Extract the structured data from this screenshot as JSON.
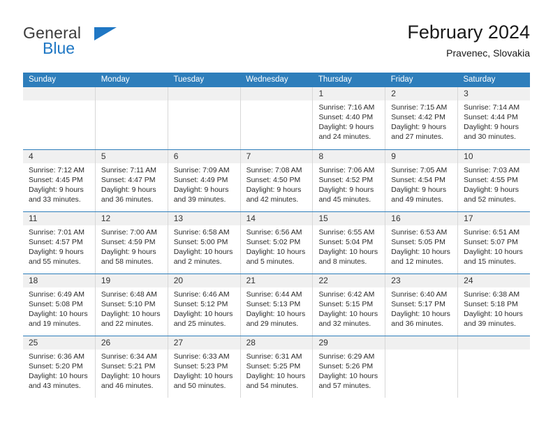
{
  "brand": {
    "name_part1": "General",
    "name_part2": "Blue",
    "accent_color": "#1f77c4"
  },
  "header": {
    "title": "February 2024",
    "location": "Pravenec, Slovakia"
  },
  "calendar": {
    "header_color": "#2e7ebb",
    "weekdays": [
      "Sunday",
      "Monday",
      "Tuesday",
      "Wednesday",
      "Thursday",
      "Friday",
      "Saturday"
    ],
    "weeks": [
      [
        {
          "day": "",
          "sunrise": "",
          "sunset": "",
          "daylight1": "",
          "daylight2": ""
        },
        {
          "day": "",
          "sunrise": "",
          "sunset": "",
          "daylight1": "",
          "daylight2": ""
        },
        {
          "day": "",
          "sunrise": "",
          "sunset": "",
          "daylight1": "",
          "daylight2": ""
        },
        {
          "day": "",
          "sunrise": "",
          "sunset": "",
          "daylight1": "",
          "daylight2": ""
        },
        {
          "day": "1",
          "sunrise": "Sunrise: 7:16 AM",
          "sunset": "Sunset: 4:40 PM",
          "daylight1": "Daylight: 9 hours",
          "daylight2": "and 24 minutes."
        },
        {
          "day": "2",
          "sunrise": "Sunrise: 7:15 AM",
          "sunset": "Sunset: 4:42 PM",
          "daylight1": "Daylight: 9 hours",
          "daylight2": "and 27 minutes."
        },
        {
          "day": "3",
          "sunrise": "Sunrise: 7:14 AM",
          "sunset": "Sunset: 4:44 PM",
          "daylight1": "Daylight: 9 hours",
          "daylight2": "and 30 minutes."
        }
      ],
      [
        {
          "day": "4",
          "sunrise": "Sunrise: 7:12 AM",
          "sunset": "Sunset: 4:45 PM",
          "daylight1": "Daylight: 9 hours",
          "daylight2": "and 33 minutes."
        },
        {
          "day": "5",
          "sunrise": "Sunrise: 7:11 AM",
          "sunset": "Sunset: 4:47 PM",
          "daylight1": "Daylight: 9 hours",
          "daylight2": "and 36 minutes."
        },
        {
          "day": "6",
          "sunrise": "Sunrise: 7:09 AM",
          "sunset": "Sunset: 4:49 PM",
          "daylight1": "Daylight: 9 hours",
          "daylight2": "and 39 minutes."
        },
        {
          "day": "7",
          "sunrise": "Sunrise: 7:08 AM",
          "sunset": "Sunset: 4:50 PM",
          "daylight1": "Daylight: 9 hours",
          "daylight2": "and 42 minutes."
        },
        {
          "day": "8",
          "sunrise": "Sunrise: 7:06 AM",
          "sunset": "Sunset: 4:52 PM",
          "daylight1": "Daylight: 9 hours",
          "daylight2": "and 45 minutes."
        },
        {
          "day": "9",
          "sunrise": "Sunrise: 7:05 AM",
          "sunset": "Sunset: 4:54 PM",
          "daylight1": "Daylight: 9 hours",
          "daylight2": "and 49 minutes."
        },
        {
          "day": "10",
          "sunrise": "Sunrise: 7:03 AM",
          "sunset": "Sunset: 4:55 PM",
          "daylight1": "Daylight: 9 hours",
          "daylight2": "and 52 minutes."
        }
      ],
      [
        {
          "day": "11",
          "sunrise": "Sunrise: 7:01 AM",
          "sunset": "Sunset: 4:57 PM",
          "daylight1": "Daylight: 9 hours",
          "daylight2": "and 55 minutes."
        },
        {
          "day": "12",
          "sunrise": "Sunrise: 7:00 AM",
          "sunset": "Sunset: 4:59 PM",
          "daylight1": "Daylight: 9 hours",
          "daylight2": "and 58 minutes."
        },
        {
          "day": "13",
          "sunrise": "Sunrise: 6:58 AM",
          "sunset": "Sunset: 5:00 PM",
          "daylight1": "Daylight: 10 hours",
          "daylight2": "and 2 minutes."
        },
        {
          "day": "14",
          "sunrise": "Sunrise: 6:56 AM",
          "sunset": "Sunset: 5:02 PM",
          "daylight1": "Daylight: 10 hours",
          "daylight2": "and 5 minutes."
        },
        {
          "day": "15",
          "sunrise": "Sunrise: 6:55 AM",
          "sunset": "Sunset: 5:04 PM",
          "daylight1": "Daylight: 10 hours",
          "daylight2": "and 8 minutes."
        },
        {
          "day": "16",
          "sunrise": "Sunrise: 6:53 AM",
          "sunset": "Sunset: 5:05 PM",
          "daylight1": "Daylight: 10 hours",
          "daylight2": "and 12 minutes."
        },
        {
          "day": "17",
          "sunrise": "Sunrise: 6:51 AM",
          "sunset": "Sunset: 5:07 PM",
          "daylight1": "Daylight: 10 hours",
          "daylight2": "and 15 minutes."
        }
      ],
      [
        {
          "day": "18",
          "sunrise": "Sunrise: 6:49 AM",
          "sunset": "Sunset: 5:08 PM",
          "daylight1": "Daylight: 10 hours",
          "daylight2": "and 19 minutes."
        },
        {
          "day": "19",
          "sunrise": "Sunrise: 6:48 AM",
          "sunset": "Sunset: 5:10 PM",
          "daylight1": "Daylight: 10 hours",
          "daylight2": "and 22 minutes."
        },
        {
          "day": "20",
          "sunrise": "Sunrise: 6:46 AM",
          "sunset": "Sunset: 5:12 PM",
          "daylight1": "Daylight: 10 hours",
          "daylight2": "and 25 minutes."
        },
        {
          "day": "21",
          "sunrise": "Sunrise: 6:44 AM",
          "sunset": "Sunset: 5:13 PM",
          "daylight1": "Daylight: 10 hours",
          "daylight2": "and 29 minutes."
        },
        {
          "day": "22",
          "sunrise": "Sunrise: 6:42 AM",
          "sunset": "Sunset: 5:15 PM",
          "daylight1": "Daylight: 10 hours",
          "daylight2": "and 32 minutes."
        },
        {
          "day": "23",
          "sunrise": "Sunrise: 6:40 AM",
          "sunset": "Sunset: 5:17 PM",
          "daylight1": "Daylight: 10 hours",
          "daylight2": "and 36 minutes."
        },
        {
          "day": "24",
          "sunrise": "Sunrise: 6:38 AM",
          "sunset": "Sunset: 5:18 PM",
          "daylight1": "Daylight: 10 hours",
          "daylight2": "and 39 minutes."
        }
      ],
      [
        {
          "day": "25",
          "sunrise": "Sunrise: 6:36 AM",
          "sunset": "Sunset: 5:20 PM",
          "daylight1": "Daylight: 10 hours",
          "daylight2": "and 43 minutes."
        },
        {
          "day": "26",
          "sunrise": "Sunrise: 6:34 AM",
          "sunset": "Sunset: 5:21 PM",
          "daylight1": "Daylight: 10 hours",
          "daylight2": "and 46 minutes."
        },
        {
          "day": "27",
          "sunrise": "Sunrise: 6:33 AM",
          "sunset": "Sunset: 5:23 PM",
          "daylight1": "Daylight: 10 hours",
          "daylight2": "and 50 minutes."
        },
        {
          "day": "28",
          "sunrise": "Sunrise: 6:31 AM",
          "sunset": "Sunset: 5:25 PM",
          "daylight1": "Daylight: 10 hours",
          "daylight2": "and 54 minutes."
        },
        {
          "day": "29",
          "sunrise": "Sunrise: 6:29 AM",
          "sunset": "Sunset: 5:26 PM",
          "daylight1": "Daylight: 10 hours",
          "daylight2": "and 57 minutes."
        },
        {
          "day": "",
          "sunrise": "",
          "sunset": "",
          "daylight1": "",
          "daylight2": ""
        },
        {
          "day": "",
          "sunrise": "",
          "sunset": "",
          "daylight1": "",
          "daylight2": ""
        }
      ]
    ]
  }
}
